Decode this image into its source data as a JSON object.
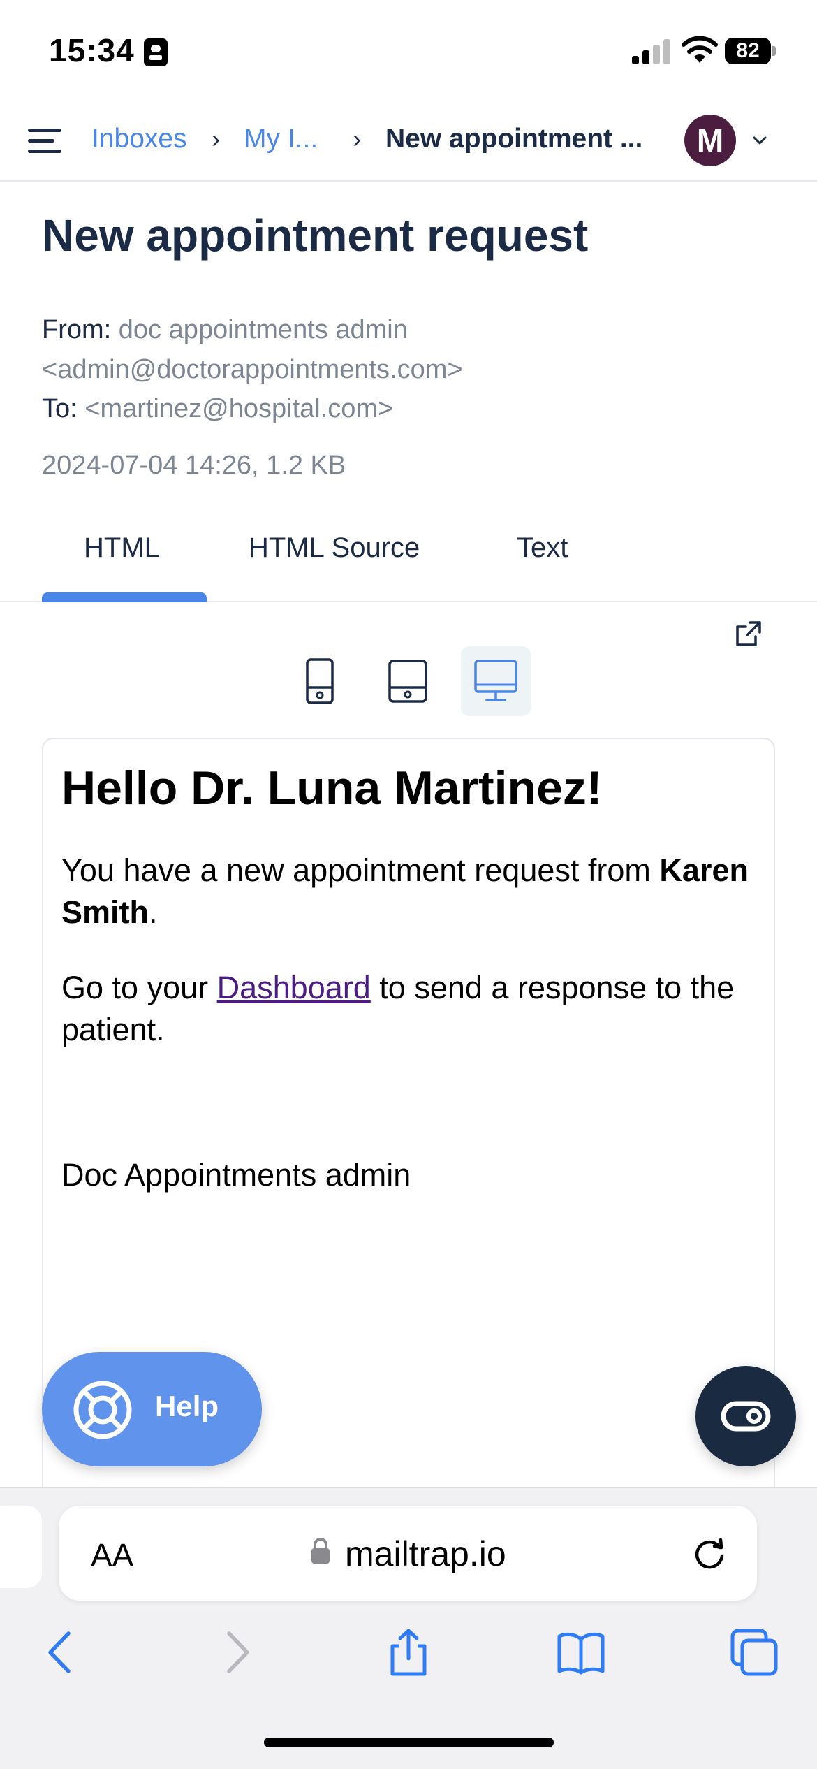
{
  "status": {
    "time": "15:34",
    "battery": "82"
  },
  "header": {
    "crumbs": [
      "Inboxes",
      "My I...",
      "New appointment ..."
    ],
    "avatar_initial": "M"
  },
  "message": {
    "title": "New appointment request",
    "from_label": "From:",
    "from_name": "doc appointments admin",
    "from_email": "<admin@doctorappointments.com>",
    "to_label": "To:",
    "to_email": "<martinez@hospital.com>",
    "date_size": "2024-07-04 14:26, 1.2 KB"
  },
  "tabs": [
    {
      "label": "HTML",
      "active": true
    },
    {
      "label": "HTML Source",
      "active": false
    },
    {
      "label": "Text",
      "active": false
    }
  ],
  "devices": [
    "mobile-view",
    "tablet-view",
    "desktop-view"
  ],
  "email": {
    "heading": "Hello Dr. Luna Martinez!",
    "line1_prefix": "You have a new appointment request from",
    "line1_name": "Karen Smith",
    "line1_suffix": ".",
    "line2_prefix": "Go to your",
    "line2_link": "Dashboard",
    "line2_suffix": "to send a response to the patient.",
    "signature": "Doc Appointments admin"
  },
  "help": {
    "label": "Help"
  },
  "browser": {
    "aa": "AA",
    "url": "mailtrap.io"
  },
  "colors": {
    "accent": "#4a86e8",
    "navy": "#1c2b45",
    "avatar": "#4b1d3f",
    "help_button": "#5f93ec"
  }
}
